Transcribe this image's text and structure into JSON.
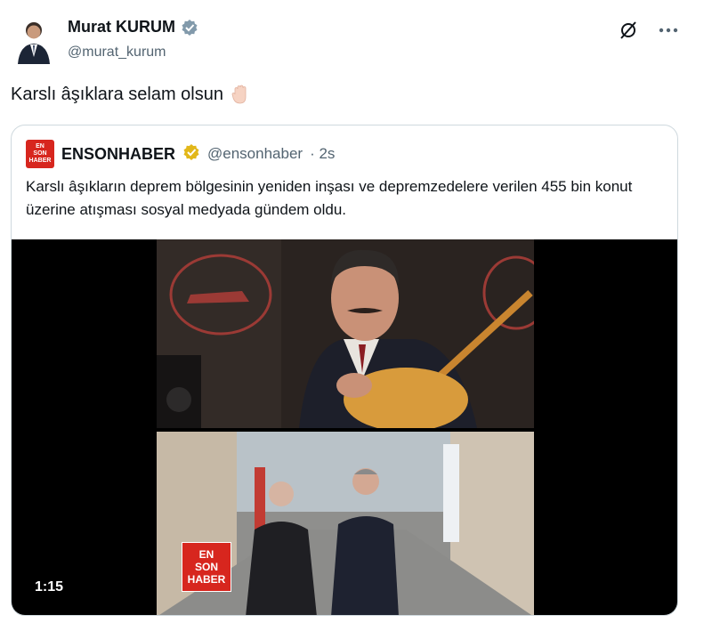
{
  "tweet": {
    "display_name": "Murat KURUM",
    "handle": "@murat_kurum",
    "text": "Karslı âşıklara selam olsun"
  },
  "quote": {
    "display_name": "ENSONHABER",
    "handle": "@ensonhaber",
    "time": "· 2s",
    "logo_line1": "EN",
    "logo_line2": "SON",
    "logo_line3": "HABER",
    "text": "Karslı âşıkların deprem bölgesinin yeniden inşası ve depremzedelere verilen 455 bin konut üzerine atışması sosyal medyada gündem oldu."
  },
  "video": {
    "duration": "1:15",
    "tag_line1": "EN",
    "tag_line2": "SON",
    "tag_line3": "HABER"
  },
  "colors": {
    "verified": "#829aab",
    "verified_gold": "#e2b719",
    "brand_red": "#d7261e"
  },
  "icons": [
    "grok-icon",
    "more-icon",
    "verified-icon",
    "raised-hand-icon"
  ]
}
